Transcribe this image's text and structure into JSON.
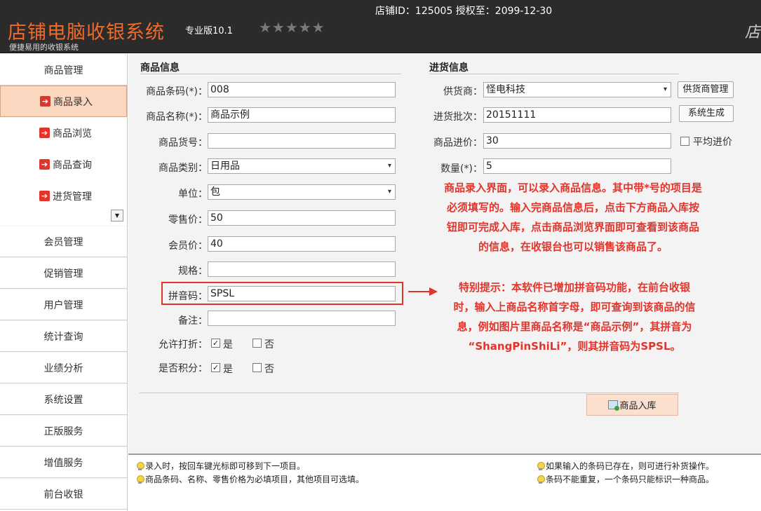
{
  "header": {
    "store_info": "店铺ID：125005 授权至：2099-12-30",
    "app_title": "店铺电脑收银系统",
    "edition": "专业版10.1",
    "stars": "★★★★★",
    "tagline": "便捷易用的收银系统",
    "right_cut": "店"
  },
  "sidebar": {
    "main_items": [
      "商品管理",
      "会员管理",
      "促销管理",
      "用户管理",
      "统计查询",
      "业绩分析",
      "系统设置",
      "正版服务",
      "增值服务",
      "前台收银"
    ],
    "sub_items": [
      {
        "label": "商品录入",
        "active": true
      },
      {
        "label": "商品浏览",
        "active": false
      },
      {
        "label": "商品查询",
        "active": false
      },
      {
        "label": "进货管理",
        "active": false
      }
    ],
    "scroll_icon": "▼"
  },
  "product_info": {
    "title": "商品信息",
    "barcode_label": "商品条码(*)：",
    "barcode_value": "008",
    "name_label": "商品名称(*)：",
    "name_value": "商品示例",
    "item_no_label": "商品货号：",
    "item_no_value": "",
    "category_label": "商品类别：",
    "category_value": "日用品",
    "unit_label": "单位：",
    "unit_value": "包",
    "retail_label": "零售价：",
    "retail_value": "50",
    "member_label": "会员价：",
    "member_value": "40",
    "spec_label": "规格：",
    "spec_value": "",
    "pinyin_label": "拼音码：",
    "pinyin_value": "SPSL",
    "remark_label": "备注：",
    "remark_value": "",
    "discount_label": "允许打折：",
    "points_label": "是否积分：",
    "yes": "是",
    "no": "否",
    "check_mark": "✓"
  },
  "purchase_info": {
    "title": "进货信息",
    "supplier_label": "供货商：",
    "supplier_value": "怪电科技",
    "supplier_btn": "供货商管理",
    "batch_label": "进货批次：",
    "batch_value": "20151111",
    "gen_btn": "系统生成",
    "cost_label": "商品进价：",
    "cost_value": "30",
    "avg_label": "平均进价",
    "qty_label": "数量(*)：",
    "qty_value": "5"
  },
  "annotations": {
    "note1": [
      "商品录入界面，可以录入商品信息。其中带*号的项目是",
      "必须填写的。输入完商品信息后，点击下方商品入库按",
      "钮即可完成入库，点击商品浏览界面即可查看到该商品",
      "的信息，在收银台也可以销售该商品了。"
    ],
    "note2": [
      "特别提示：本软件已增加拼音码功能，在前台收银",
      "时，输入上商品名称首字母，即可查询到该商品的信",
      "息，例如图片里商品名称是“商品示例”，其拼音为",
      "“ShangPinShiLi”，则其拼音码为SPSL。"
    ]
  },
  "submit_btn": "商品入库",
  "tips": {
    "left": [
      "录入时，按回车键光标即可移到下一项目。",
      "商品条码、名称、零售价格为必填项目，其他项目可选填。"
    ],
    "right": [
      "如果输入的条码已存在，则可进行补货操作。",
      "条码不能重复，一个条码只能标识一种商品。"
    ]
  },
  "colors": {
    "accent": "#f06a2a",
    "annotation": "#e3342b",
    "active_nav": "#fbd7bf"
  }
}
